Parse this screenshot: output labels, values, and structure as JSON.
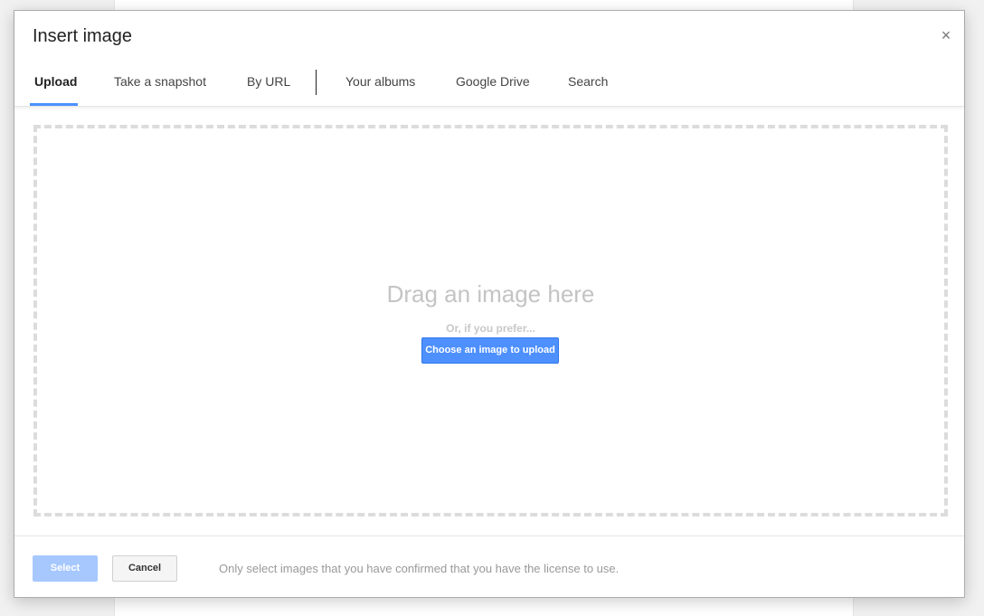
{
  "dialog": {
    "title": "Insert image",
    "close_label": "×"
  },
  "tabs": [
    {
      "label": "Upload",
      "active": true
    },
    {
      "label": "Take a snapshot",
      "active": false
    },
    {
      "label": "By URL",
      "active": false
    },
    {
      "label": "Your albums",
      "active": false
    },
    {
      "label": "Google Drive",
      "active": false
    },
    {
      "label": "Search",
      "active": false
    }
  ],
  "upload": {
    "drop_title": "Drag an image here",
    "drop_subtitle": "Or, if you prefer...",
    "choose_button": "Choose an image to upload"
  },
  "footer": {
    "select_label": "Select",
    "cancel_label": "Cancel",
    "note": "Only select images that you have confirmed that you have the license to use."
  },
  "colors": {
    "accent": "#4d90fe",
    "accent_disabled": "#a6c8ff",
    "dashed_border": "#dcdcdc"
  },
  "icons": {
    "close": "close-icon"
  }
}
